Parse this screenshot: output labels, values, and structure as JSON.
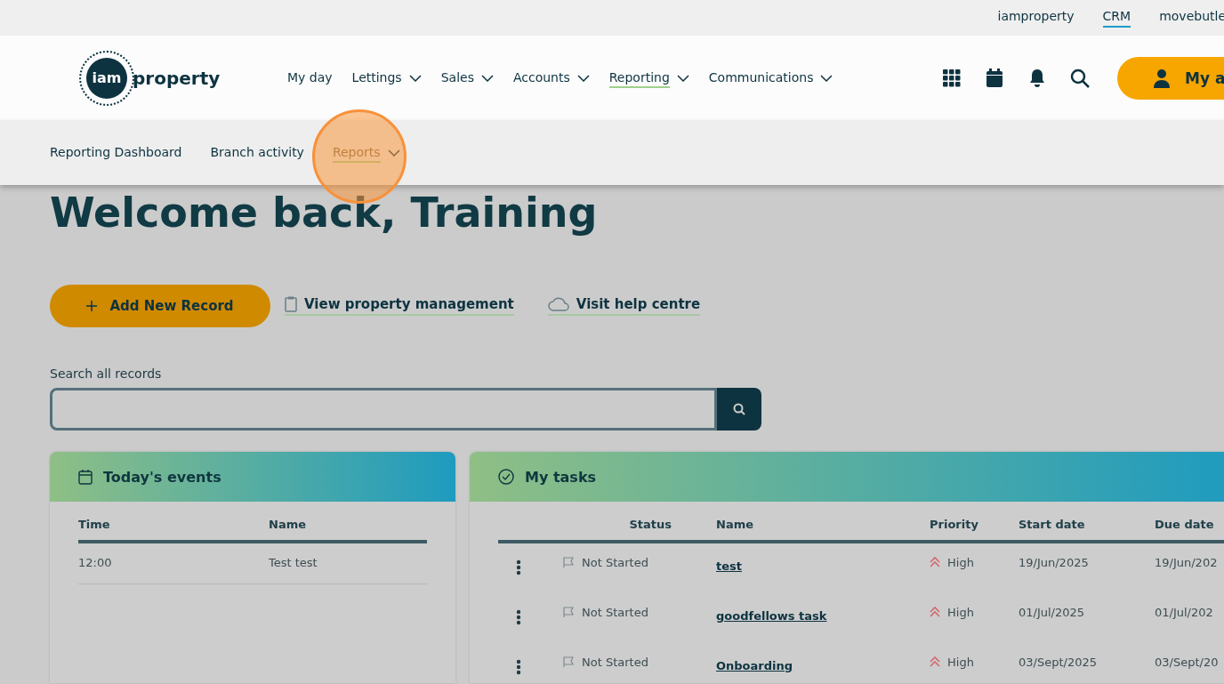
{
  "top_links": [
    {
      "label": "iamproperty",
      "selected": false
    },
    {
      "label": "CRM",
      "selected": true
    },
    {
      "label": "movebutle",
      "selected": false
    }
  ],
  "logo": {
    "mark": "iam",
    "word": "property"
  },
  "nav": [
    {
      "label": "My day",
      "dropdown": false,
      "selected": false
    },
    {
      "label": "Lettings",
      "dropdown": true,
      "selected": false
    },
    {
      "label": "Sales",
      "dropdown": true,
      "selected": false
    },
    {
      "label": "Accounts",
      "dropdown": true,
      "selected": false
    },
    {
      "label": "Reporting",
      "dropdown": true,
      "selected": true
    },
    {
      "label": "Communications",
      "dropdown": true,
      "selected": false
    }
  ],
  "account_button": "My a",
  "subnav": [
    {
      "label": "Reporting Dashboard",
      "dropdown": false,
      "selected": false
    },
    {
      "label": "Branch activity",
      "dropdown": false,
      "selected": false
    },
    {
      "label": "Reports",
      "dropdown": true,
      "selected": true
    }
  ],
  "welcome": "Welcome back, Training",
  "actions": {
    "primary": "Add New Record",
    "links": [
      {
        "kind": "clipboard",
        "label": "View property management"
      },
      {
        "kind": "cloud",
        "label": "Visit help centre"
      }
    ]
  },
  "search": {
    "label": "Search all records"
  },
  "events": {
    "title": "Today's events",
    "columns": [
      "Time",
      "Name"
    ],
    "rows": [
      [
        "12:00",
        "Test test"
      ]
    ]
  },
  "tasks": {
    "title": "My tasks",
    "columns": [
      "Status",
      "Name",
      "Priority",
      "Start date",
      "Due date"
    ],
    "rows": [
      {
        "status": "Not Started",
        "name": "test",
        "priority": "High",
        "start": "19/Jun/2025",
        "due": "19/Jun/202"
      },
      {
        "status": "Not Started",
        "name": "goodfellows task",
        "priority": "High",
        "start": "01/Jul/2025",
        "due": "01/Jul/202"
      },
      {
        "status": "Not Started",
        "name": "Onboarding",
        "priority": "High",
        "start": "03/Sept/2025",
        "due": "03/Sept/20"
      }
    ]
  }
}
